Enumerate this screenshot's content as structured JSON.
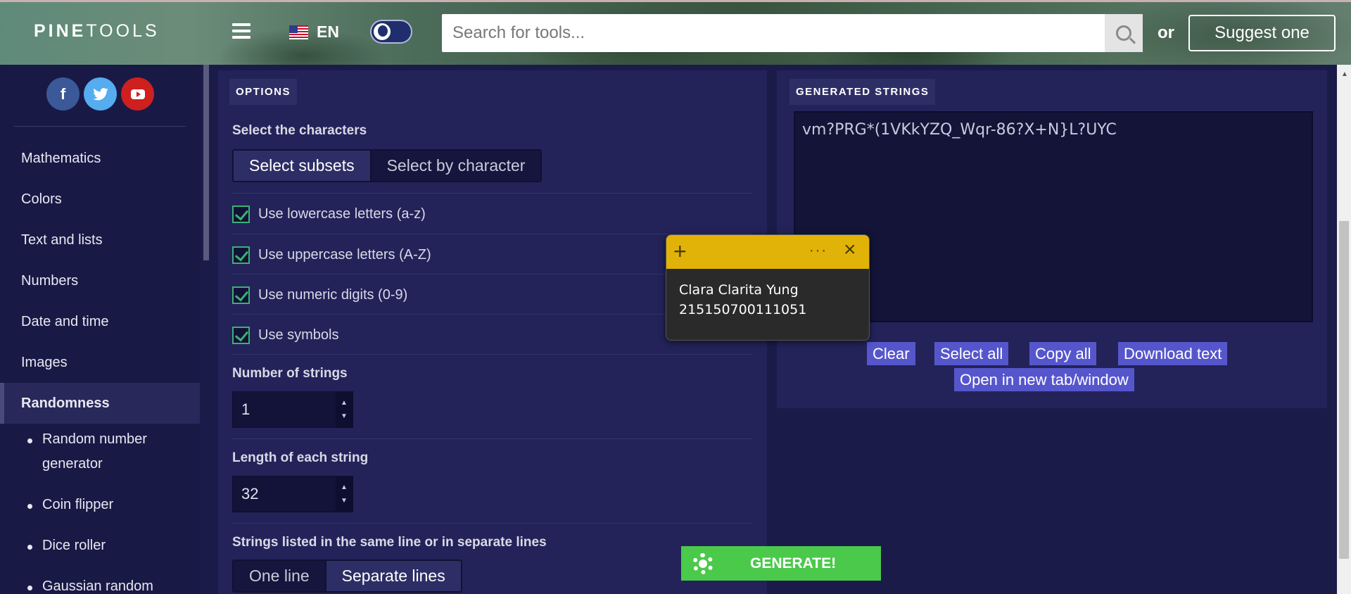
{
  "header": {
    "logo_bold": "PINE",
    "logo_thin": "TOOLS",
    "language": "EN",
    "search_placeholder": "Search for tools...",
    "or_text": "or",
    "suggest_label": "Suggest one"
  },
  "sidebar": {
    "menu": [
      {
        "label": "Mathematics"
      },
      {
        "label": "Colors"
      },
      {
        "label": "Text and lists"
      },
      {
        "label": "Numbers"
      },
      {
        "label": "Date and time"
      },
      {
        "label": "Images"
      },
      {
        "label": "Randomness"
      }
    ],
    "submenu": [
      {
        "label": "Random number generator"
      },
      {
        "label": "Coin flipper"
      },
      {
        "label": "Dice roller"
      },
      {
        "label": "Gaussian random"
      }
    ]
  },
  "options": {
    "tab_label": "OPTIONS",
    "select_chars_title": "Select the characters",
    "select_subsets": "Select subsets",
    "select_by_character": "Select by character",
    "checks": [
      {
        "label": "Use lowercase letters (a-z)",
        "checked": true
      },
      {
        "label": "Use uppercase letters (A-Z)",
        "checked": true
      },
      {
        "label": "Use numeric digits (0-9)",
        "checked": true
      },
      {
        "label": "Use symbols",
        "checked": true
      }
    ],
    "num_strings_title": "Number of strings",
    "num_strings_value": "1",
    "length_title": "Length of each string",
    "length_value": "32",
    "lines_title": "Strings listed in the same line or in separate lines",
    "one_line": "One line",
    "separate_lines": "Separate lines"
  },
  "generated": {
    "tab_label": "GENERATED STRINGS",
    "output": "vm?PRG*(1VKkYZQ_Wqr-86?X+N}L?UYC",
    "clear": "Clear",
    "select_all": "Select all",
    "copy_all": "Copy all",
    "download": "Download text",
    "open_new": "Open in new tab/window"
  },
  "note": {
    "line1": "Clara Clarita Yung",
    "line2": "215150700111051"
  },
  "generate_label": "GENERATE!"
}
